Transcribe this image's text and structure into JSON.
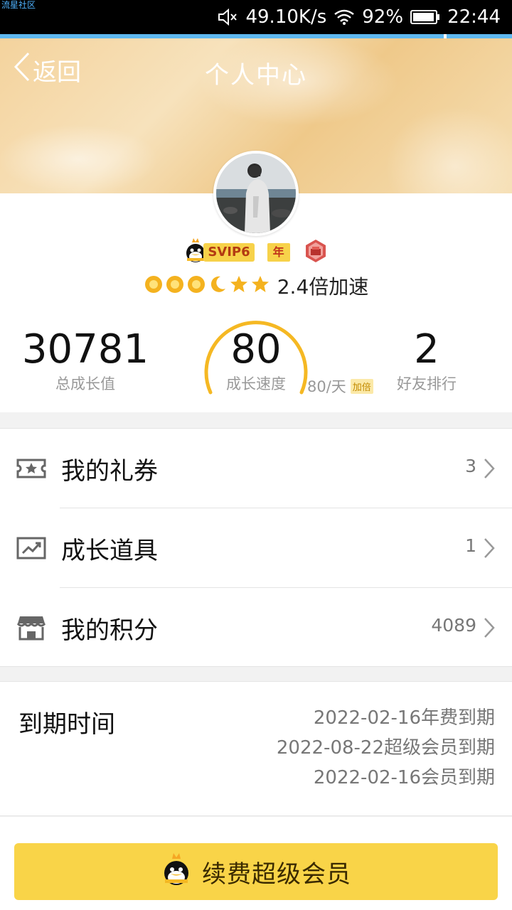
{
  "status_bar": {
    "watermark": "流星社区",
    "network_speed": "49.10K/s",
    "battery": "92%",
    "time": "22:44"
  },
  "header": {
    "back_label": "返回",
    "title": "个人中心"
  },
  "profile": {
    "svip_label": "SVIP6",
    "year_badge": "年",
    "level_icons": [
      "sun-icon",
      "sun-icon",
      "sun-icon",
      "moon-icon",
      "star-icon",
      "star-icon"
    ],
    "speedup": "2.4倍加速"
  },
  "stats": {
    "growth_total": {
      "value": "30781",
      "label": "总成长值"
    },
    "growth_speed": {
      "value": "80",
      "label": "成长速度",
      "per_day": "80/天",
      "double_badge": "加倍"
    },
    "friend_rank": {
      "value": "2",
      "label": "好友排行"
    }
  },
  "menu": [
    {
      "label": "我的礼券",
      "value": "3",
      "icon": "ticket-icon"
    },
    {
      "label": "成长道具",
      "value": "1",
      "icon": "trend-chart-icon"
    },
    {
      "label": "我的积分",
      "value": "4089",
      "icon": "store-icon"
    }
  ],
  "expiry": {
    "title": "到期时间",
    "lines": [
      "2022-02-16年费到期",
      "2022-08-22超级会员到期",
      "2022-02-16会员到期"
    ]
  },
  "renew_button": {
    "label": "续费超级会员"
  },
  "colors": {
    "accent_yellow": "#f9d448",
    "gauge_orange": "#f5b823",
    "status_bar_bg": "#000000"
  }
}
